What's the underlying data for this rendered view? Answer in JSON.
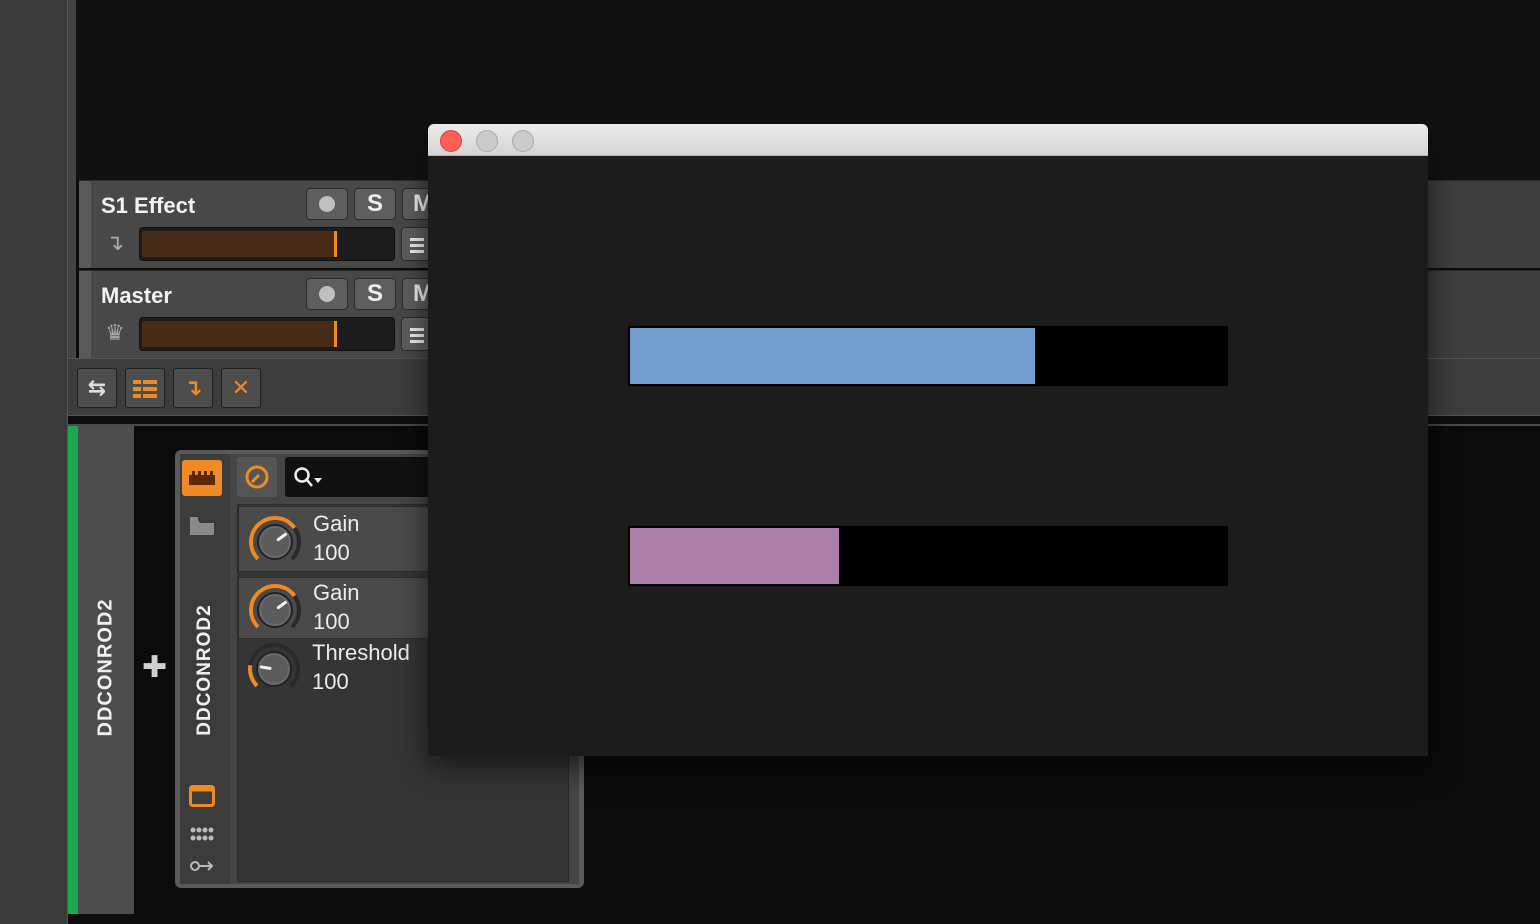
{
  "tracks": [
    {
      "name": "S1 Effect",
      "solo_label": "S",
      "mute_label": "M",
      "icon": "return-arrow-icon",
      "meter_level": 0.78
    },
    {
      "name": "Master",
      "solo_label": "S",
      "mute_label": "M",
      "icon": "crown-icon",
      "meter_level": 0.78
    }
  ],
  "toolbar": {
    "icons": [
      "swap-arrows-icon",
      "device-list-icon",
      "insert-arrow-icon",
      "remove-x-icon"
    ],
    "remove_label": "✕"
  },
  "device_panel": {
    "track_label": "DDCONROD2",
    "device_label": "DDCONROD2",
    "add_label": "✚",
    "search_placeholder": "",
    "knobs": [
      {
        "label": "Gain",
        "value": "100",
        "position": 0.7
      },
      {
        "label": "Gain",
        "value": "100",
        "position": 0.7
      },
      {
        "label": "Threshold",
        "value": "100",
        "position": 0.2
      }
    ]
  },
  "plugin_window": {
    "bars": [
      {
        "level": 0.68,
        "color": "#6f9ecf"
      },
      {
        "level": 0.35,
        "color": "#aa7ea9"
      }
    ],
    "close_color": "#fc5f57",
    "inactive_color": "#cbcbcb"
  },
  "colors": {
    "accent": "#f08a24",
    "track_active": "#1aa84e"
  }
}
